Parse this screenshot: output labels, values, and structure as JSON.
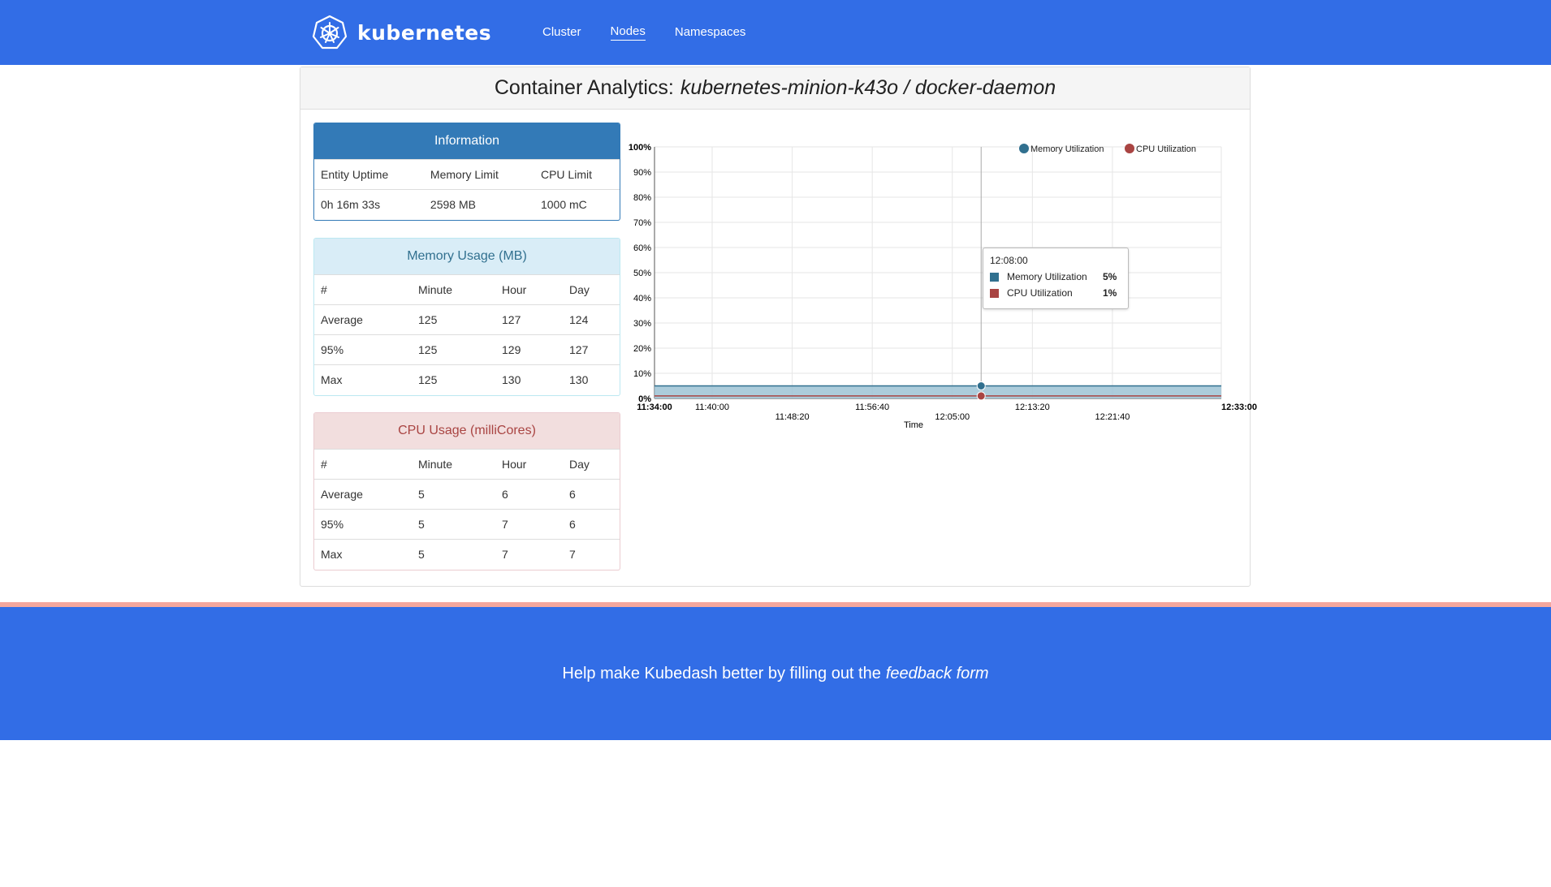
{
  "nav": {
    "brand": "kubernetes",
    "links": [
      "Cluster",
      "Nodes",
      "Namespaces"
    ]
  },
  "header": {
    "title_prefix": "Container Analytics:",
    "title_entity": "kubernetes-minion-k43o / docker-daemon"
  },
  "info": {
    "title": "Information",
    "columns": [
      "Entity Uptime",
      "Memory Limit",
      "CPU Limit"
    ],
    "values": [
      "0h 16m 33s",
      "2598 MB",
      "1000 mC"
    ]
  },
  "memory": {
    "title": "Memory Usage (MB)",
    "columns": [
      "#",
      "Minute",
      "Hour",
      "Day"
    ],
    "rows": [
      [
        "Average",
        "125",
        "127",
        "124"
      ],
      [
        "95%",
        "125",
        "129",
        "127"
      ],
      [
        "Max",
        "125",
        "130",
        "130"
      ]
    ]
  },
  "cpu": {
    "title": "CPU Usage (milliCores)",
    "columns": [
      "#",
      "Minute",
      "Hour",
      "Day"
    ],
    "rows": [
      [
        "Average",
        "5",
        "6",
        "6"
      ],
      [
        "95%",
        "5",
        "7",
        "6"
      ],
      [
        "Max",
        "5",
        "7",
        "7"
      ]
    ]
  },
  "chart_data": {
    "type": "area",
    "xlabel": "Time",
    "ylabel": "",
    "ylim": [
      0,
      100
    ],
    "y_ticks": [
      "0%",
      "10%",
      "20%",
      "30%",
      "40%",
      "50%",
      "60%",
      "70%",
      "80%",
      "90%",
      "100%"
    ],
    "x_ticks": [
      "11:34:00",
      "11:40:00",
      "11:48:20",
      "11:56:40",
      "12:05:00",
      "12:13:20",
      "12:21:40",
      "12:33:00"
    ],
    "grid": true,
    "legend_position": "top-right",
    "series": [
      {
        "name": "Memory Utilization",
        "color": "#31708f",
        "fill": "#9ec3d5",
        "x": [
          "11:34:00",
          "12:33:00"
        ],
        "values": [
          5,
          5
        ]
      },
      {
        "name": "CPU Utilization",
        "color": "#a94442",
        "x": [
          "11:34:00",
          "12:33:00"
        ],
        "values": [
          1,
          1
        ]
      }
    ],
    "tooltip": {
      "time": "12:08:00",
      "items": [
        {
          "name": "Memory Utilization",
          "value": "5%",
          "color": "#31708f"
        },
        {
          "name": "CPU Utilization",
          "value": "1%",
          "color": "#a94442"
        }
      ]
    }
  },
  "footer": {
    "text": "Help make Kubedash better by filling out the",
    "link": "feedback form"
  }
}
